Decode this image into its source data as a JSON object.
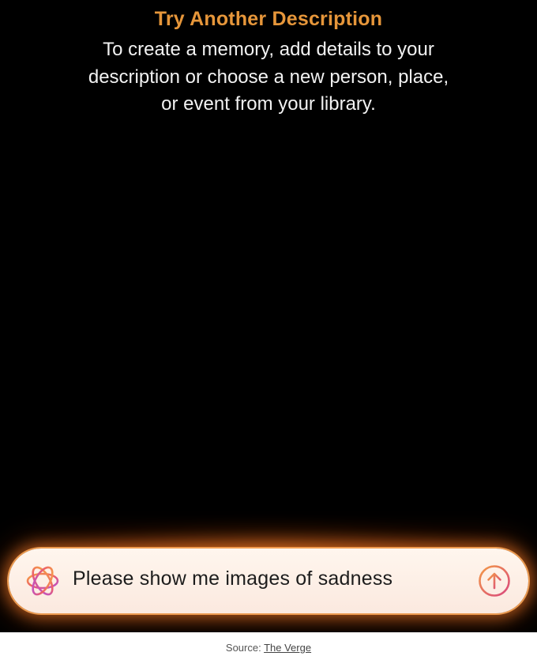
{
  "message": {
    "title": "Try Another Description",
    "body": "To create a memory, add details to your description or choose a new person, place, or event from your library."
  },
  "prompt": {
    "text": "Please show me images of sadness",
    "icon": "apple-intelligence-icon",
    "send_icon": "arrow-up-circle-icon"
  },
  "caption": {
    "prefix": "Source: ",
    "link_text": "The Verge"
  },
  "colors": {
    "title": "#e6963a",
    "background": "#000000",
    "glow": "#ff8c28",
    "send_icon": "#e0507a"
  }
}
